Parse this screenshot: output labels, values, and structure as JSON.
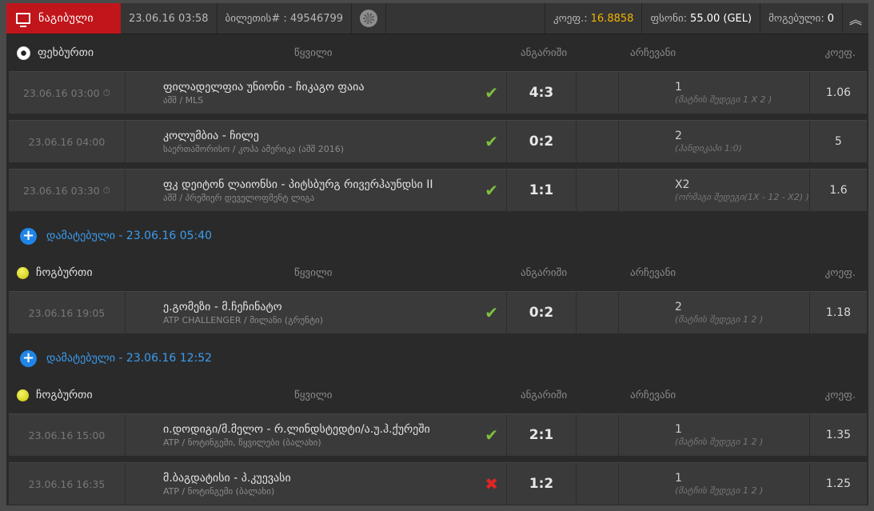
{
  "header": {
    "played_label": "ნაგიბული",
    "datetime": "23.06.16 03:58",
    "ticket_label": "ბილეთის# :",
    "ticket_number": "49546799",
    "coef_label": "კოეფ.:",
    "coef_value": "16.8858",
    "stake_label": "ფსონი:",
    "stake_value": "55.00 (GEL)",
    "win_label": "მოგებული:",
    "win_value": "0",
    "collapse_glyph": "︽"
  },
  "columns": {
    "event": "წყვილი",
    "score": "ანგარიში",
    "choice": "არჩევანი",
    "odds": "კოეფ."
  },
  "sections": [
    {
      "sport": "ფეხბურთი",
      "icon": "soccer-ball-icon",
      "rows": [
        {
          "date": "23.06.16 03:00",
          "clock": true,
          "name": "ფილადელფია უნიონი - ჩიკაგო ფაია",
          "league": "აშშ / MLS",
          "status": "win",
          "score": "4:3",
          "pick": "1",
          "market": "(მატჩის შედეგი 1 X 2 )",
          "odds": "1.06"
        },
        {
          "date": "23.06.16 04:00",
          "clock": false,
          "name": "კოლუმბია - ჩილე",
          "league": "საერთაშორისო / კოპა ამერიკა (აშშ 2016)",
          "status": "win",
          "score": "0:2",
          "pick": "2",
          "market": "(ჰანდიკაპი 1:0)",
          "odds": "5"
        },
        {
          "date": "23.06.16 03:30",
          "clock": true,
          "name": "ფკ დეიტონ ლაიონსი - პიტსბურგ რივერჰაუნდსი II",
          "league": "აშშ / პრემიერ დეველოფმენტ ლიგა",
          "status": "win",
          "score": "1:1",
          "pick": "X2",
          "market": "(ორმაგი შედეგი(1X - 12 - X2) )",
          "odds": "1.6"
        }
      ]
    },
    {
      "added": "დამატებული - 23.06.16 05:40",
      "sport": "ჩოგბურთი",
      "icon": "tennis-ball-icon",
      "rows": [
        {
          "date": "23.06.16 19:05",
          "clock": false,
          "name": "ე.გომეზი - მ.ჩეჩინატო",
          "league": "ATP CHALLENGER / მილანი (გრუნტი)",
          "status": "win",
          "score": "0:2",
          "pick": "2",
          "market": "(მატჩის შედეგი 1 2 )",
          "odds": "1.18"
        }
      ]
    },
    {
      "added": "დამატებული - 23.06.16 12:52",
      "sport": "ჩოგბურთი",
      "icon": "tennis-ball-icon",
      "rows": [
        {
          "date": "23.06.16 15:00",
          "clock": false,
          "name": "ი.დოდიგი/მ.მელო - რ.ლინდსტედტი/ა.უ.ჰ.ქურეში",
          "league": "ATP / ნოტინგემი, წყვილები (ბალახი)",
          "status": "win",
          "score": "2:1",
          "pick": "1",
          "market": "(მატჩის შედეგი 1 2 )",
          "odds": "1.35"
        },
        {
          "date": "23.06.16 16:35",
          "clock": false,
          "name": "მ.ბაგდატისი - პ.კუევასი",
          "league": "ATP / ნოტინგემი (ბალახი)",
          "status": "loss",
          "score": "1:2",
          "pick": "1",
          "market": "(მატჩის შედეგი 1 2 )",
          "odds": "1.25"
        }
      ]
    }
  ],
  "colors": {
    "accent_red": "#c0161b",
    "highlight": "#f2b400",
    "win": "#7ec13c",
    "loss": "#e02525",
    "added_blue": "#3b9cf0"
  }
}
